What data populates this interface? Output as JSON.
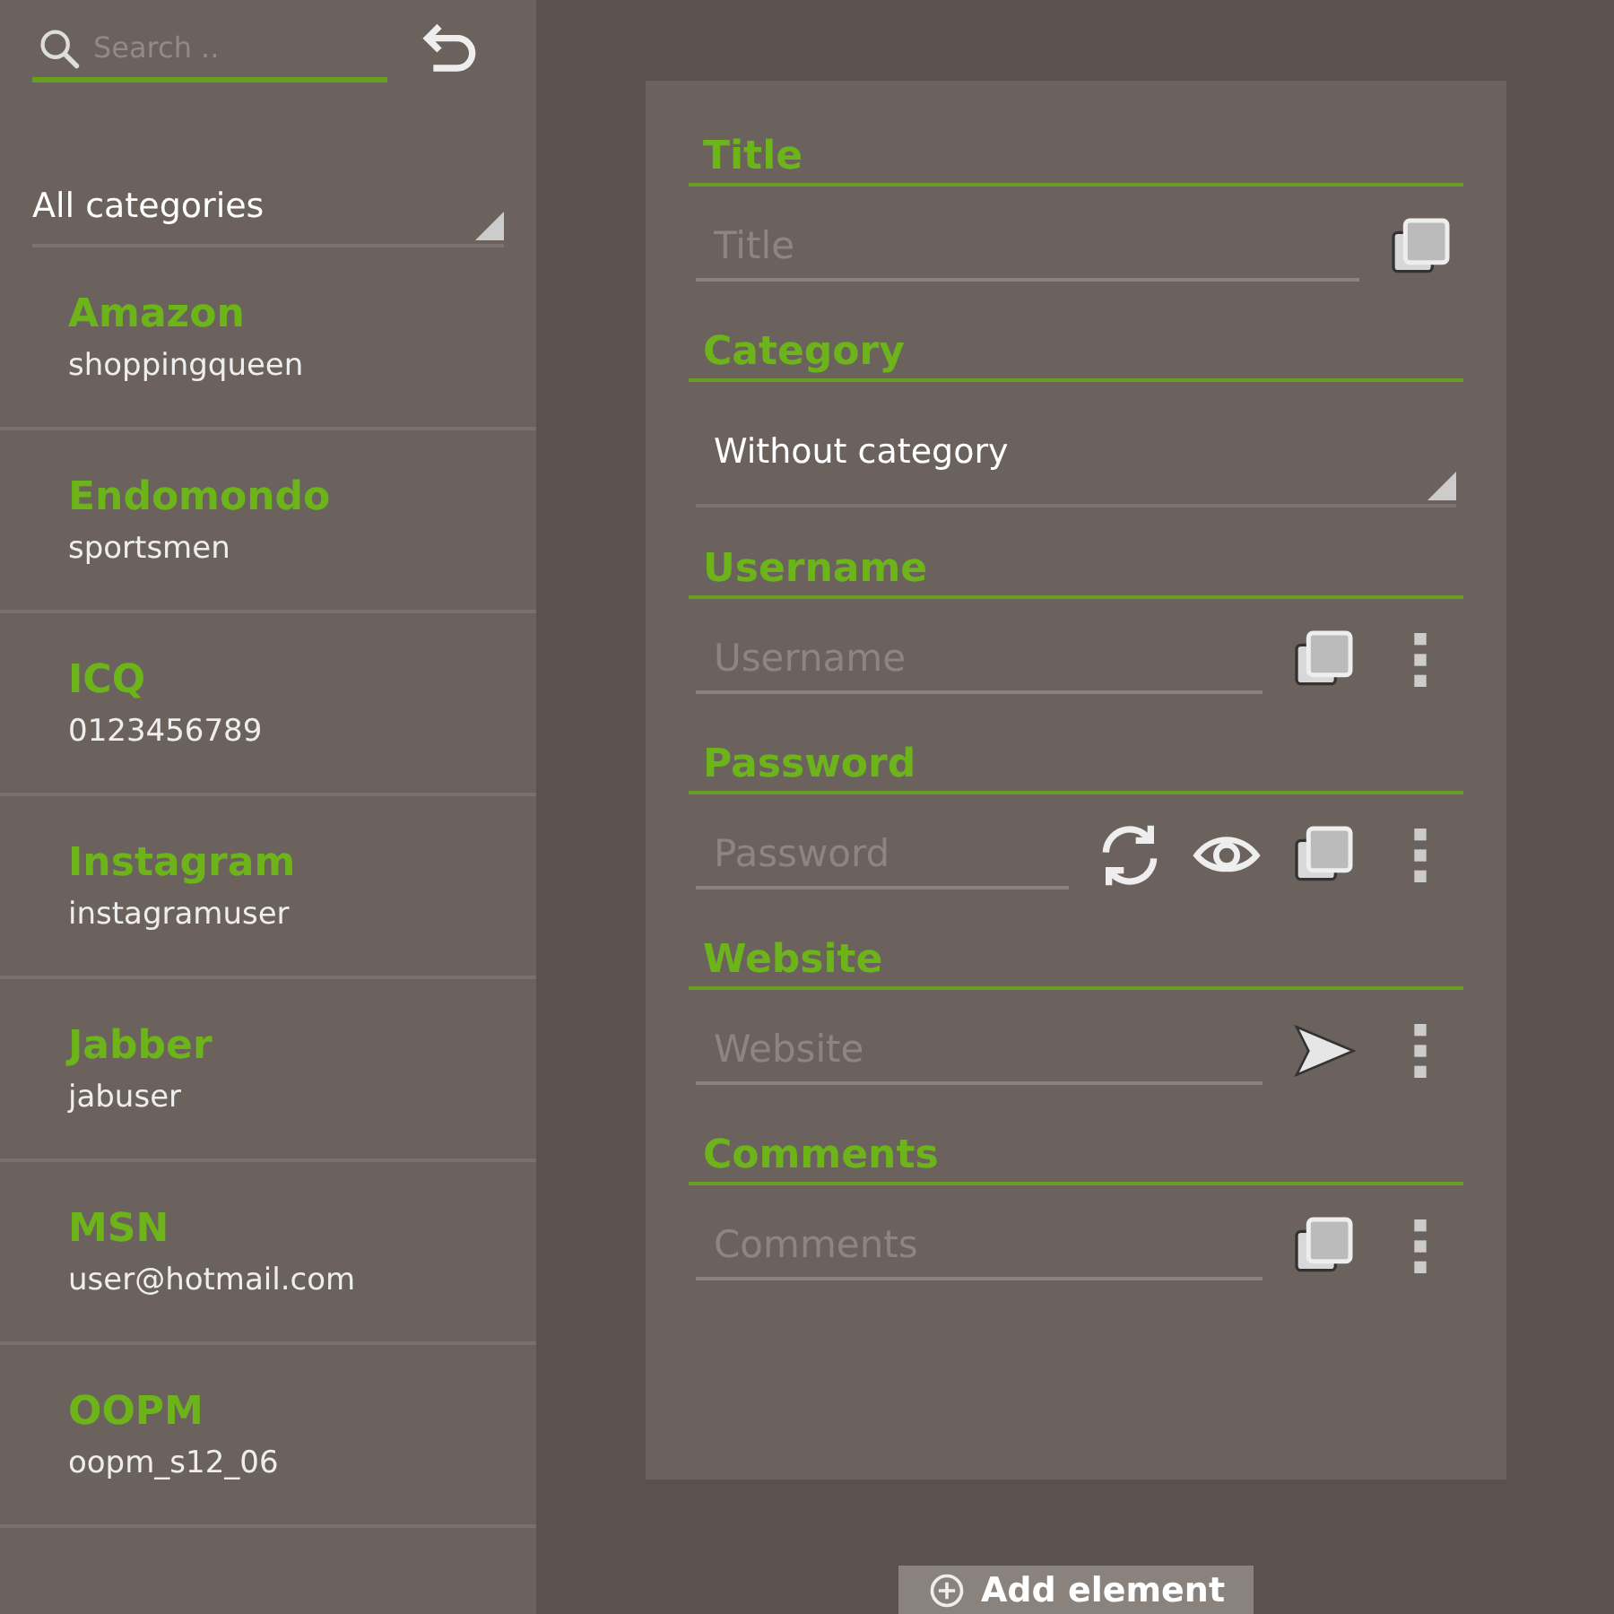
{
  "search": {
    "placeholder": "Search .."
  },
  "category_filter": {
    "value": "All categories"
  },
  "entries": [
    {
      "name": "Amazon",
      "username": "shoppingqueen"
    },
    {
      "name": "Endomondo",
      "username": "sportsmen"
    },
    {
      "name": "ICQ",
      "username": "0123456789"
    },
    {
      "name": "Instagram",
      "username": "instagramuser"
    },
    {
      "name": "Jabber",
      "username": "jabuser"
    },
    {
      "name": "MSN",
      "username": "user@hotmail.com"
    },
    {
      "name": "OOPM",
      "username": "oopm_s12_06"
    }
  ],
  "fields": [
    {
      "label": "Title",
      "kind": "text",
      "placeholder": "Title",
      "actions": [
        {
          "kind": "copy"
        }
      ]
    },
    {
      "label": "Category",
      "kind": "select",
      "value": "Without category"
    },
    {
      "label": "Username",
      "kind": "text",
      "placeholder": "Username",
      "actions": [
        {
          "kind": "copy"
        },
        {
          "kind": "menu"
        }
      ]
    },
    {
      "label": "Password",
      "kind": "text",
      "placeholder": "Password",
      "actions": [
        {
          "kind": "generate"
        },
        {
          "kind": "reveal"
        },
        {
          "kind": "copy"
        },
        {
          "kind": "menu"
        }
      ]
    },
    {
      "label": "Website",
      "kind": "text",
      "placeholder": "Website",
      "actions": [
        {
          "kind": "open"
        },
        {
          "kind": "menu"
        }
      ]
    },
    {
      "label": "Comments",
      "kind": "text",
      "placeholder": "Comments",
      "actions": [
        {
          "kind": "copy"
        },
        {
          "kind": "menu"
        }
      ]
    }
  ],
  "add_button": {
    "label": "Add element"
  }
}
